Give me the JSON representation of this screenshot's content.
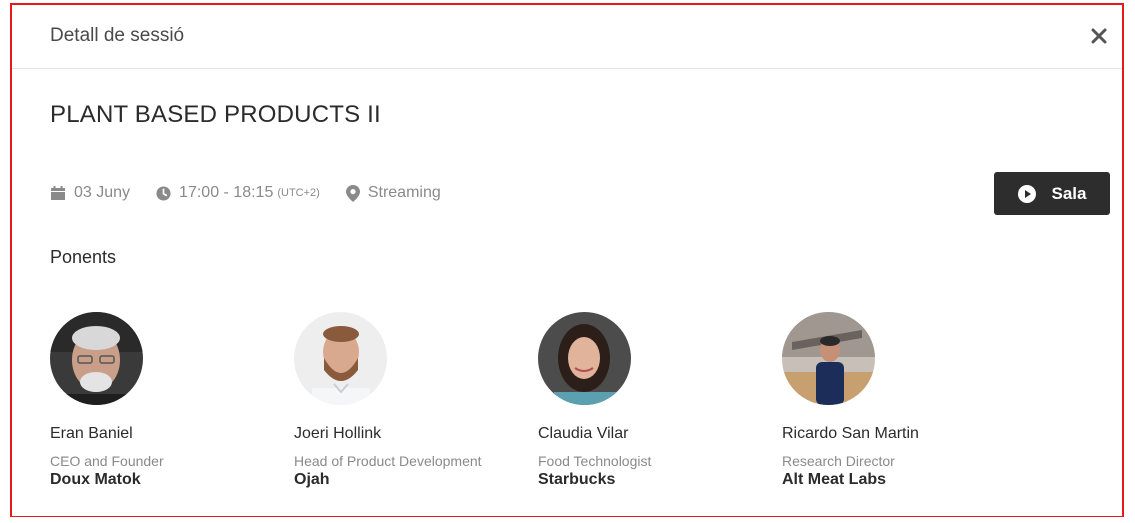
{
  "modal": {
    "title": "Detall de sessió"
  },
  "session": {
    "title": "PLANT BASED PRODUCTS II",
    "date": "03 Juny",
    "time": "17:00 - 18:15",
    "timezone": "(UTC+2)",
    "location": "Streaming",
    "room_button": "Sala"
  },
  "speakers_section": {
    "label": "Ponents"
  },
  "speakers": [
    {
      "name": "Eran Baniel",
      "role": "CEO and Founder",
      "org": "Doux Matok"
    },
    {
      "name": "Joeri Hollink",
      "role": "Head of Product Development",
      "org": "Ojah"
    },
    {
      "name": "Claudia Vilar",
      "role": "Food Technologist",
      "org": "Starbucks"
    },
    {
      "name": "Ricardo San Martin",
      "role": "Research Director",
      "org": "Alt Meat Labs"
    }
  ],
  "icons": {
    "close": "close-icon",
    "calendar": "calendar-icon",
    "clock": "clock-icon",
    "location": "map-pin-icon",
    "play": "play-circle-icon"
  },
  "colors": {
    "border": "#e8191c",
    "button_bg": "#2d2d2d",
    "muted_text": "#8a8a8a"
  }
}
